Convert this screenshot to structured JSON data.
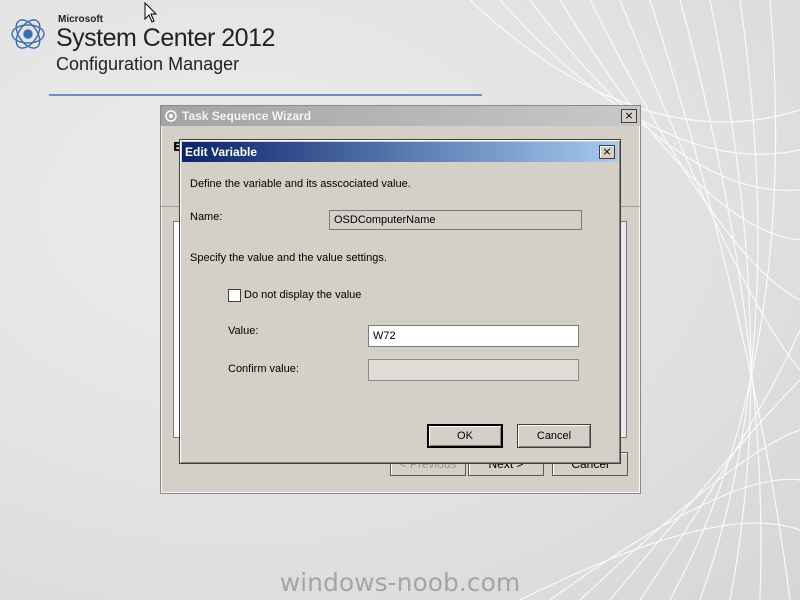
{
  "logo": {
    "brand": "Microsoft",
    "line1": "System Center 2012",
    "line2": "Configuration Manager"
  },
  "wizard": {
    "title": "Task Sequence Wizard",
    "partial_heading": "E",
    "buttons": {
      "previous": "< Previous",
      "next": "Next >",
      "cancel": "Cancel"
    }
  },
  "dialog": {
    "title": "Edit Variable",
    "intro": "Define the variable and its asscociated value.",
    "name_label": "Name:",
    "name_value": "OSDComputerName",
    "value_intro": "Specify the value and the value settings.",
    "checkbox_label": "Do not display the value",
    "checkbox_checked": false,
    "value_label": "Value:",
    "value_value": "W72",
    "confirm_label": "Confirm value:",
    "confirm_value": "",
    "ok_label": "OK",
    "cancel_label": "Cancel",
    "close_glyph": "×"
  },
  "watermark": "windows-noob.com",
  "colors": {
    "dialog_title_start": "#0a246a",
    "dialog_title_end": "#a6caf0",
    "logo_line": "#6a8fc1"
  }
}
